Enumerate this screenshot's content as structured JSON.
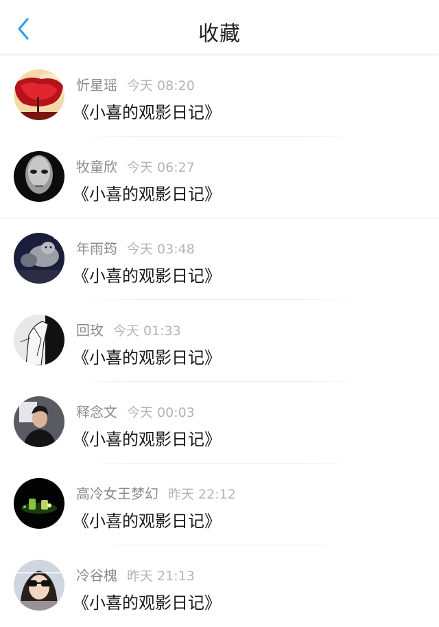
{
  "header": {
    "title": "收藏",
    "back_icon": "chevron-left-icon",
    "accent": "#2a9df4"
  },
  "items": [
    {
      "name": "忻星瑶",
      "time": "今天 08:20",
      "title": "《小喜的观影日记》",
      "avatar": "red-tree-avatar"
    },
    {
      "name": "牧童欣",
      "time": "今天 06:27",
      "title": "《小喜的观影日记》",
      "avatar": "white-mask-avatar"
    },
    {
      "name": "年雨筠",
      "time": "今天 03:48",
      "title": "《小喜的观影日记》",
      "avatar": "tiger-night-avatar"
    },
    {
      "name": "回玫",
      "time": "今天 01:33",
      "title": "《小喜的观影日记》",
      "avatar": "sketch-avatar"
    },
    {
      "name": "释念文",
      "time": "今天 00:03",
      "title": "《小喜的观影日记》",
      "avatar": "man-portrait-avatar"
    },
    {
      "name": "高冷女王梦幻",
      "time": "昨天 22:12",
      "title": "《小喜的观影日记》",
      "avatar": "glowing-glasses-avatar"
    },
    {
      "name": "冷谷槐",
      "time": "昨天 21:13",
      "title": "《小喜的观影日记》",
      "avatar": "girl-sunglasses-avatar"
    }
  ]
}
